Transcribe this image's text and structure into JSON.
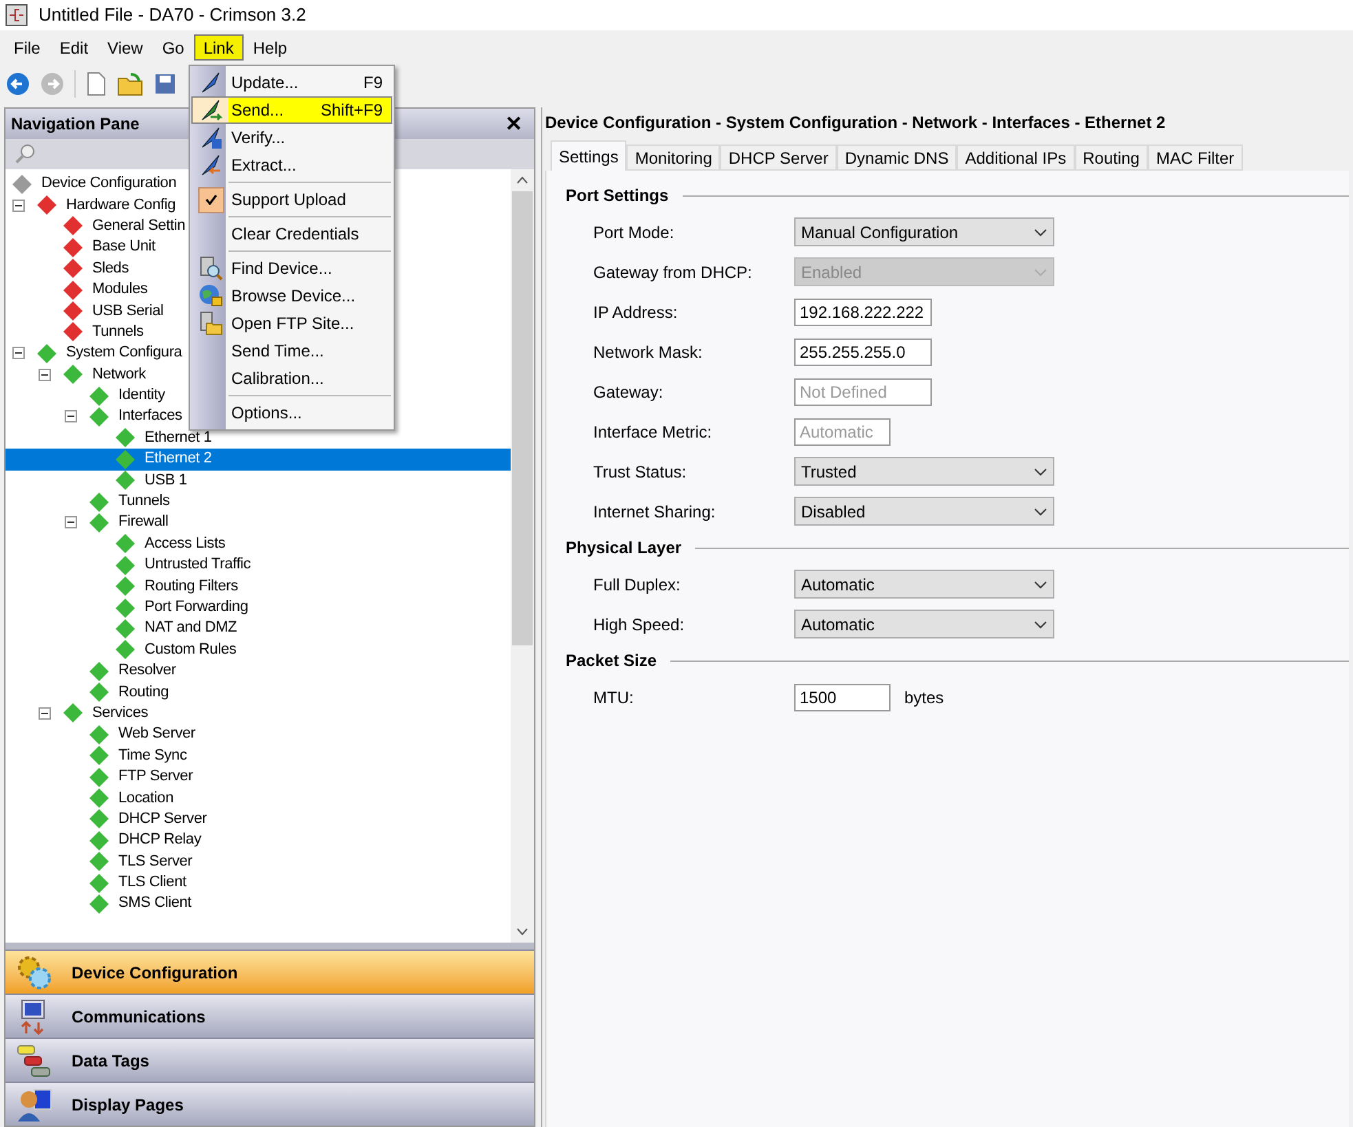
{
  "window": {
    "title": "Untitled File - DA70 - Crimson 3.2"
  },
  "menubar": [
    {
      "label": "File",
      "selected": false
    },
    {
      "label": "Edit",
      "selected": false
    },
    {
      "label": "View",
      "selected": false
    },
    {
      "label": "Go",
      "selected": false
    },
    {
      "label": "Link",
      "selected": true
    },
    {
      "label": "Help",
      "selected": false
    }
  ],
  "link_menu": [
    {
      "kind": "item",
      "label": "Update...",
      "shortcut": "F9",
      "selected": false
    },
    {
      "kind": "item",
      "label": "Send...",
      "shortcut": "Shift+F9",
      "selected": true
    },
    {
      "kind": "item",
      "label": "Verify...",
      "selected": false
    },
    {
      "kind": "item",
      "label": "Extract...",
      "selected": false
    },
    {
      "kind": "separator"
    },
    {
      "kind": "check",
      "label": "Support Upload",
      "checked": true,
      "selected": false
    },
    {
      "kind": "separator"
    },
    {
      "kind": "item",
      "label": "Clear Credentials",
      "selected": false
    },
    {
      "kind": "separator"
    },
    {
      "kind": "item",
      "label": "Find Device...",
      "selected": false
    },
    {
      "kind": "item",
      "label": "Browse Device...",
      "selected": false
    },
    {
      "kind": "item",
      "label": "Open FTP Site...",
      "selected": false
    },
    {
      "kind": "item",
      "label": "Send Time...",
      "selected": false
    },
    {
      "kind": "item",
      "label": "Calibration...",
      "selected": false
    },
    {
      "kind": "separator"
    },
    {
      "kind": "item",
      "label": "Options...",
      "selected": false
    }
  ],
  "navigation_pane": {
    "title": "Navigation Pane",
    "close": "✕",
    "tree": [
      {
        "label": "Device Configuration",
        "color": "#9a9a9a",
        "selected": false,
        "children": [
          {
            "label": "Hardware Config",
            "color": "#e03030",
            "expanded": true,
            "selected": false,
            "children": [
              {
                "label": "General Settin",
                "color": "#e03030",
                "selected": false
              },
              {
                "label": "Base Unit",
                "color": "#e03030",
                "selected": false
              },
              {
                "label": "Sleds",
                "color": "#e03030",
                "selected": false
              },
              {
                "label": "Modules",
                "color": "#e03030",
                "selected": false
              },
              {
                "label": "USB Serial",
                "color": "#e03030",
                "selected": false
              },
              {
                "label": "Tunnels",
                "color": "#e03030",
                "selected": false
              }
            ]
          },
          {
            "label": "System Configura",
            "color": "#3cb83c",
            "expanded": true,
            "selected": false,
            "children": [
              {
                "label": "Network",
                "color": "#3cb83c",
                "expanded": true,
                "selected": false,
                "children": [
                  {
                    "label": "Identity",
                    "color": "#3cb83c",
                    "selected": false
                  },
                  {
                    "label": "Interfaces",
                    "color": "#3cb83c",
                    "expanded": true,
                    "selected": false,
                    "children": [
                      {
                        "label": "Ethernet 1",
                        "color": "#3cb83c",
                        "selected": false
                      },
                      {
                        "label": "Ethernet 2",
                        "color": "#3cb83c",
                        "selected": true
                      },
                      {
                        "label": "USB 1",
                        "color": "#3cb83c",
                        "selected": false
                      }
                    ]
                  },
                  {
                    "label": "Tunnels",
                    "color": "#3cb83c",
                    "selected": false
                  },
                  {
                    "label": "Firewall",
                    "color": "#3cb83c",
                    "expanded": true,
                    "selected": false,
                    "children": [
                      {
                        "label": "Access Lists",
                        "color": "#3cb83c",
                        "selected": false
                      },
                      {
                        "label": "Untrusted Traffic",
                        "color": "#3cb83c",
                        "selected": false
                      },
                      {
                        "label": "Routing Filters",
                        "color": "#3cb83c",
                        "selected": false
                      },
                      {
                        "label": "Port Forwarding",
                        "color": "#3cb83c",
                        "selected": false
                      },
                      {
                        "label": "NAT and DMZ",
                        "color": "#3cb83c",
                        "selected": false
                      },
                      {
                        "label": "Custom Rules",
                        "color": "#3cb83c",
                        "selected": false
                      }
                    ]
                  },
                  {
                    "label": "Resolver",
                    "color": "#3cb83c",
                    "selected": false
                  },
                  {
                    "label": "Routing",
                    "color": "#3cb83c",
                    "selected": false
                  }
                ]
              },
              {
                "label": "Services",
                "color": "#3cb83c",
                "expanded": true,
                "selected": false,
                "children": [
                  {
                    "label": "Web Server",
                    "color": "#3cb83c",
                    "selected": false
                  },
                  {
                    "label": "Time Sync",
                    "color": "#3cb83c",
                    "selected": false
                  },
                  {
                    "label": "FTP Server",
                    "color": "#3cb83c",
                    "selected": false
                  },
                  {
                    "label": "Location",
                    "color": "#3cb83c",
                    "selected": false
                  },
                  {
                    "label": "DHCP Server",
                    "color": "#3cb83c",
                    "selected": false
                  },
                  {
                    "label": "DHCP Relay",
                    "color": "#3cb83c",
                    "selected": false
                  },
                  {
                    "label": "TLS Server",
                    "color": "#3cb83c",
                    "selected": false
                  },
                  {
                    "label": "TLS Client",
                    "color": "#3cb83c",
                    "selected": false
                  },
                  {
                    "label": "SMS Client",
                    "color": "#3cb83c",
                    "selected": false
                  }
                ]
              }
            ]
          }
        ]
      }
    ],
    "sections": [
      {
        "label": "Device Configuration",
        "selected": true
      },
      {
        "label": "Communications",
        "selected": false
      },
      {
        "label": "Data Tags",
        "selected": false
      },
      {
        "label": "Display Pages",
        "selected": false
      }
    ]
  },
  "editor": {
    "path": "Device Configuration - System Configuration - Network - Interfaces - Ethernet 2",
    "tabs": [
      {
        "label": "Settings",
        "selected": true
      },
      {
        "label": "Monitoring",
        "selected": false
      },
      {
        "label": "DHCP Server",
        "selected": false
      },
      {
        "label": "Dynamic DNS",
        "selected": false
      },
      {
        "label": "Additional IPs",
        "selected": false
      },
      {
        "label": "Routing",
        "selected": false
      },
      {
        "label": "MAC Filter",
        "selected": false
      }
    ],
    "groups": [
      {
        "title": "Port Settings",
        "fields": [
          {
            "label": "Port Mode:",
            "kind": "dropdown",
            "value": "Manual Configuration",
            "disabled": false
          },
          {
            "label": "Gateway from DHCP:",
            "kind": "dropdown",
            "value": "Enabled",
            "disabled": true
          },
          {
            "label": "IP Address:",
            "kind": "text",
            "value": "192.168.222.222"
          },
          {
            "label": "Network Mask:",
            "kind": "text",
            "value": "255.255.255.0"
          },
          {
            "label": "Gateway:",
            "kind": "text",
            "placeholder": "Not Defined"
          },
          {
            "label": "Interface Metric:",
            "kind": "short",
            "placeholder": "Automatic"
          },
          {
            "label": "Trust Status:",
            "kind": "dropdown",
            "value": "Trusted",
            "disabled": false
          },
          {
            "label": "Internet Sharing:",
            "kind": "dropdown",
            "value": "Disabled",
            "disabled": false
          }
        ]
      },
      {
        "title": "Physical Layer",
        "fields": [
          {
            "label": "Full Duplex:",
            "kind": "dropdown",
            "value": "Automatic",
            "disabled": false
          },
          {
            "label": "High Speed:",
            "kind": "dropdown",
            "value": "Automatic",
            "disabled": false
          }
        ]
      },
      {
        "title": "Packet Size",
        "fields": [
          {
            "label": "MTU:",
            "kind": "short",
            "value": "1500",
            "unit": "bytes"
          }
        ]
      }
    ]
  }
}
